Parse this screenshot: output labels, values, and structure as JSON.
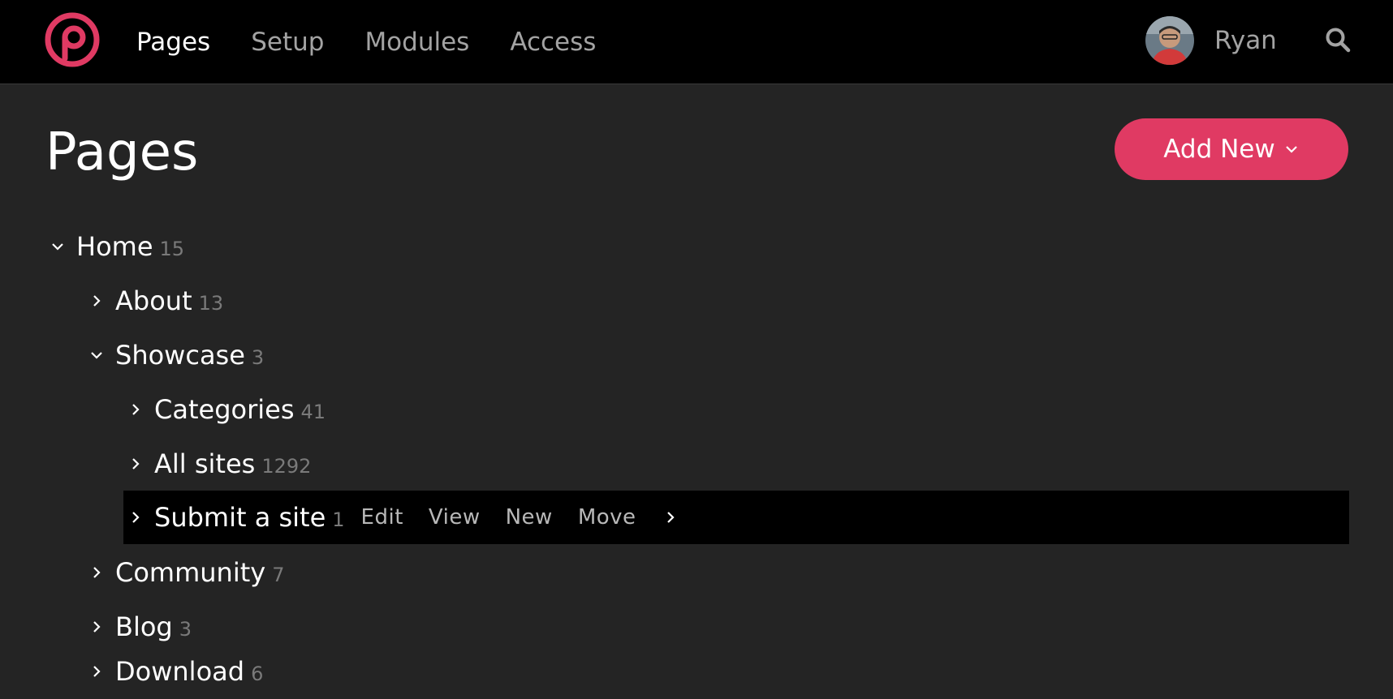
{
  "header": {
    "logo_icon": "processwire-logo-icon",
    "accent_color": "#e03a63",
    "nav": [
      {
        "label": "Pages",
        "active": true
      },
      {
        "label": "Setup",
        "active": false
      },
      {
        "label": "Modules",
        "active": false
      },
      {
        "label": "Access",
        "active": false
      }
    ],
    "user_name": "Ryan",
    "search_icon": "search-icon"
  },
  "main": {
    "title": "Pages",
    "add_new_label": "Add New"
  },
  "tree": {
    "home": {
      "label": "Home",
      "count": "15",
      "expanded": true
    },
    "about": {
      "label": "About",
      "count": "13",
      "expanded": false
    },
    "showcase": {
      "label": "Showcase",
      "count": "3",
      "expanded": true
    },
    "categories": {
      "label": "Categories",
      "count": "41",
      "expanded": false
    },
    "all_sites": {
      "label": "All sites",
      "count": "1292",
      "expanded": false
    },
    "submit_a_site": {
      "label": "Submit a site",
      "count": "1",
      "expanded": false,
      "selected": true,
      "actions": {
        "edit": "Edit",
        "view": "View",
        "new": "New",
        "move": "Move"
      }
    },
    "community": {
      "label": "Community",
      "count": "7",
      "expanded": false
    },
    "blog": {
      "label": "Blog",
      "count": "3",
      "expanded": false
    },
    "download": {
      "label": "Download",
      "count": "6",
      "expanded": false
    }
  }
}
